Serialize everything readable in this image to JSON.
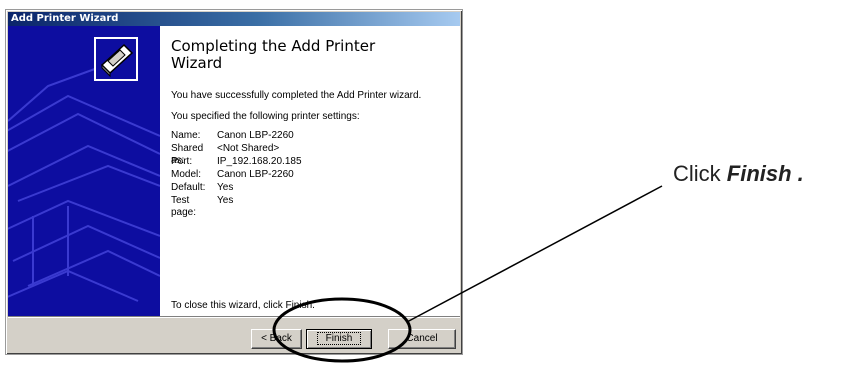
{
  "window": {
    "title": "Add Printer Wizard"
  },
  "heading": "Completing the Add Printer Wizard",
  "success_text": "You have successfully completed the Add Printer wizard.",
  "settings_intro": "You specified the following printer settings:",
  "settings": [
    {
      "label": "Name:",
      "value": "Canon LBP-2260"
    },
    {
      "label": "Shared as:",
      "value": "<Not Shared>"
    },
    {
      "label": "Port:",
      "value": "IP_192.168.20.185"
    },
    {
      "label": "Model:",
      "value": "Canon LBP-2260"
    },
    {
      "label": "Default:",
      "value": "Yes"
    },
    {
      "label": "Test page:",
      "value": "Yes"
    }
  ],
  "close_text": "To close this wizard, click Finish.",
  "buttons": {
    "back": "< Back",
    "finish": "Finish",
    "cancel": "Cancel"
  },
  "callout": {
    "prefix": "Click",
    "emphasis": "Finish ."
  },
  "colors": {
    "banner": "#0d0da0",
    "titlebar": "#0a246a",
    "face": "#d4d0c8"
  },
  "icons": [
    "printer-wizard-icon"
  ]
}
